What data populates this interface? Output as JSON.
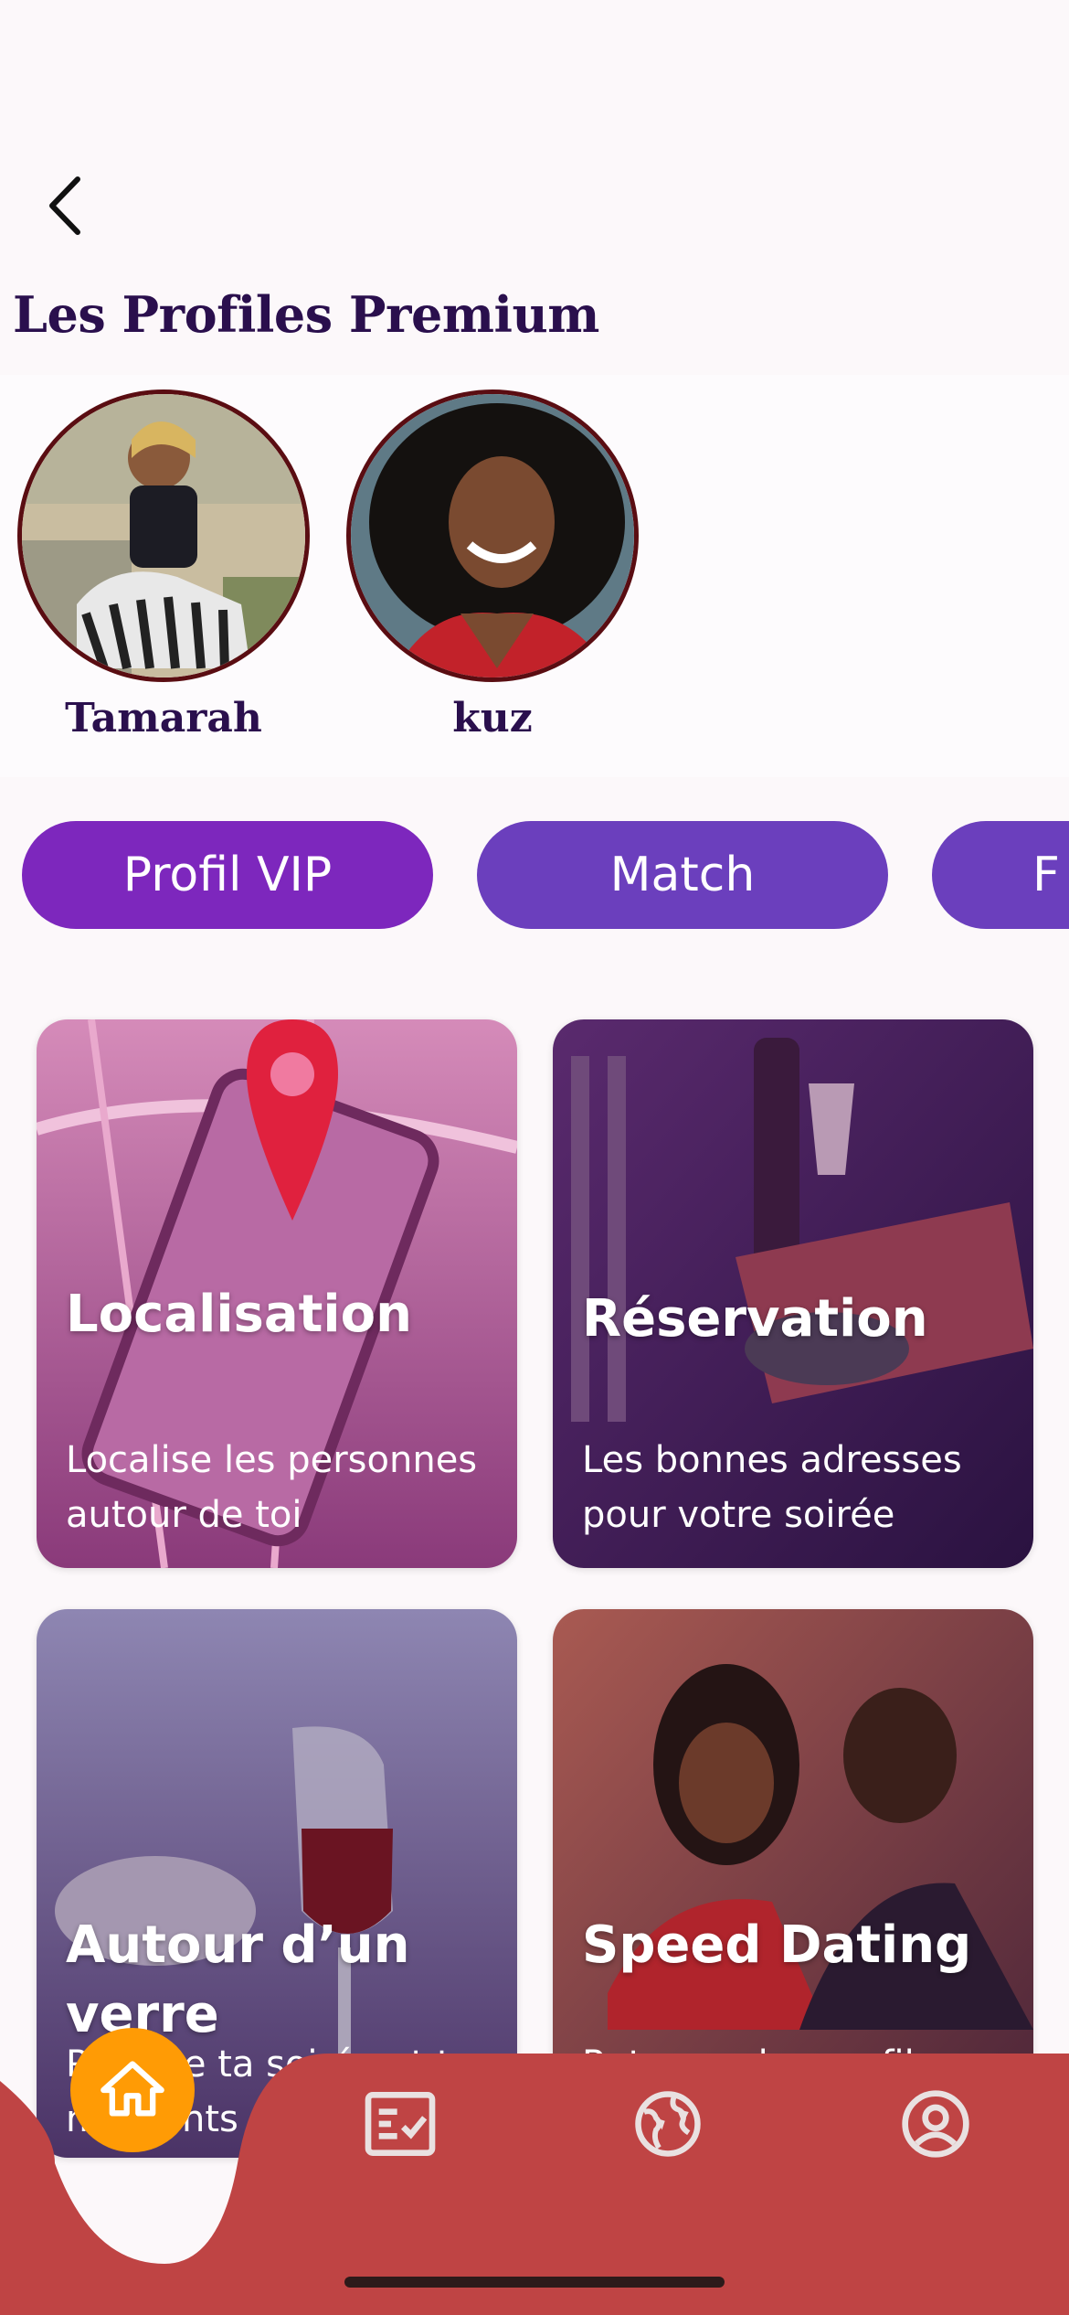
{
  "header": {
    "title": "Les Profiles Premium",
    "back_icon": "chevron-left-icon"
  },
  "premium_profiles": [
    {
      "name": "Tamarah"
    },
    {
      "name": "kuz"
    }
  ],
  "chips": [
    {
      "label": "Profil VIP",
      "active": true
    },
    {
      "label": "Match",
      "active": false
    },
    {
      "label": "F",
      "active": false
    }
  ],
  "cards": [
    {
      "title": "Localisation",
      "subtitle": "Localise les personnes autour de toi"
    },
    {
      "title": "Réservation",
      "subtitle": "Les bonnes adresses pour votre soirée"
    },
    {
      "title": "Autour d’un verre",
      "subtitle": "Partage ta soirée et tes moments"
    },
    {
      "title": "Speed Dating",
      "subtitle": "Retrouve les profils"
    }
  ],
  "bottom_nav": {
    "items": [
      {
        "icon": "home-icon",
        "active": true
      },
      {
        "icon": "checklist-icon",
        "active": false
      },
      {
        "icon": "globe-icon",
        "active": false
      },
      {
        "icon": "account-circle-icon",
        "active": false
      }
    ]
  },
  "colors": {
    "accent_purple": "#6b3fbd",
    "active_chip": "#7d27bd",
    "title_color": "#2a0f4d",
    "nav_background": "#bf4444",
    "home_button": "#ff9b05"
  }
}
